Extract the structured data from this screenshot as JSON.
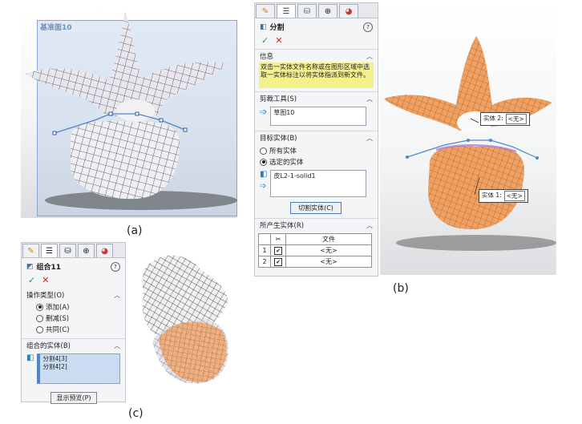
{
  "captions": {
    "a": "(a)",
    "b": "(b)",
    "c": "(c)"
  },
  "fig_a": {
    "plane_label": "基准面10"
  },
  "panel_b": {
    "title": "分割",
    "info_header": "信息",
    "info_text": "双击一实体文件名称或在图形区域中选取一实体标注以将实体指派到新文件。",
    "trim_header": "剪裁工具(S)",
    "trim_value": "草图10",
    "target_header": "目标实体(B)",
    "radio_all": "所有实体",
    "radio_selected": "选定的实体",
    "target_value": "皮L2-1-solid1",
    "cut_button": "切割实体(C)",
    "result_header": "所产生实体(R)",
    "table_col": "文件",
    "rows": [
      {
        "num": "1",
        "value": "<无>"
      },
      {
        "num": "2",
        "value": "<无>"
      }
    ]
  },
  "fig_b": {
    "callout1_label": "实体 2:",
    "callout1_value": "<无>",
    "callout2_label": "实体 1:",
    "callout2_value": "<无>"
  },
  "panel_c": {
    "title": "组合11",
    "op_header": "操作类型(O)",
    "op_add": "添加(A)",
    "op_sub": "删减(S)",
    "op_common": "共同(C)",
    "bodies_header": "组合的实体(B)",
    "bodies": [
      "分割4[3]",
      "分割4[2]"
    ],
    "preview_button": "显示预览(P)"
  },
  "colors": {
    "accent": "#4f86c6",
    "mesh_orange": "#f0a162",
    "info_bg": "#f4f18a"
  },
  "icons": [
    "feature-manager-icon",
    "property-manager-icon",
    "config-manager-icon",
    "dimxpert-icon",
    "appearance-icon",
    "split-icon",
    "combine-icon",
    "check-icon",
    "close-icon",
    "help-icon",
    "pin-icon",
    "solid-body-icon",
    "arrow-icon",
    "chevron-up-icon"
  ]
}
